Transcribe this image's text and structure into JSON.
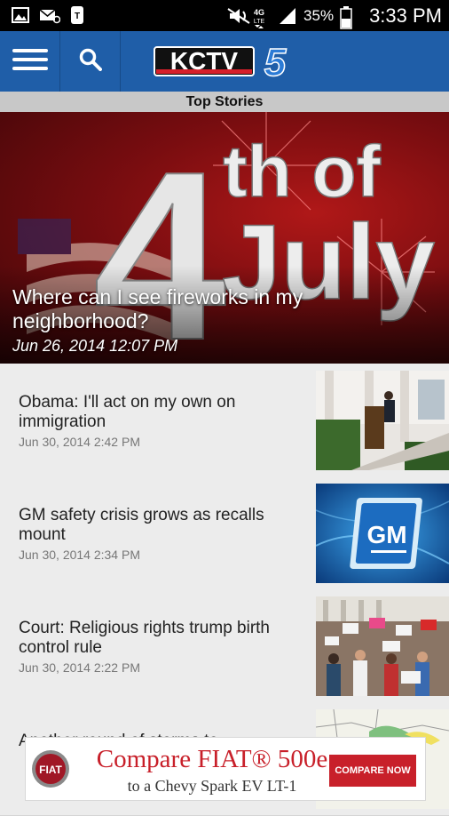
{
  "status_bar": {
    "battery_percent": "35%",
    "time": "3:33 PM",
    "network_label": "4G LTE",
    "icons": [
      "image-icon",
      "email-icon",
      "tmobile-icon",
      "mute-icon",
      "lte-icon",
      "signal-icon",
      "battery-icon"
    ]
  },
  "header": {
    "logo_text": "KCTV",
    "logo_number": "5",
    "brand_color": "#1f5ea8"
  },
  "section": {
    "title": "Top Stories"
  },
  "hero": {
    "graphic_text_number": "4",
    "graphic_text_th": "th of",
    "graphic_text_july": "July",
    "title": "Where can I see fireworks in my neighborhood?",
    "date": "Jun 26, 2014 12:07 PM"
  },
  "stories": [
    {
      "title": "Obama: I'll act on my own on immigration",
      "date": "Jun 30, 2014 2:42 PM"
    },
    {
      "title": "GM safety crisis grows as recalls mount",
      "date": "Jun 30, 2014 2:34 PM",
      "thumb_text": "GM"
    },
    {
      "title": "Court: Religious rights trump birth control rule",
      "date": "Jun 30, 2014 2:22 PM"
    },
    {
      "title": "Another round of storms to"
    }
  ],
  "ad": {
    "brand_badge": "FIAT",
    "line1": "Compare FIAT® 500e",
    "line2": "to a Chevy Spark EV LT-1",
    "cta": "COMPARE NOW",
    "accent_color": "#c8202a"
  }
}
